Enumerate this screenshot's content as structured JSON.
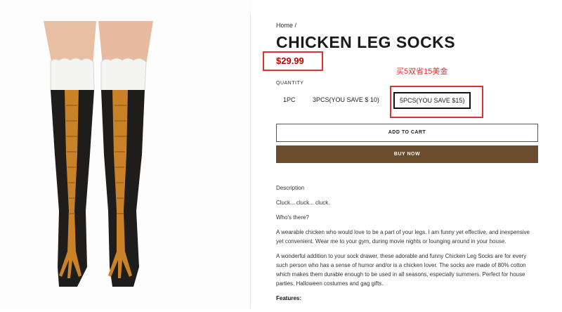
{
  "breadcrumb": "Home /",
  "title": "CHICKEN LEG SOCKS",
  "price": "$29.99",
  "promo_note": "买5双省15美金",
  "quantity": {
    "label": "QUANTITY",
    "options": [
      "1PC",
      "3PCS(YOU SAVE $ 10)",
      "5PCS(YOU SAVE $15)"
    ],
    "selected": "5PCS(YOU SAVE $15)"
  },
  "buttons": {
    "add_to_cart": "ADD TO CART",
    "buy_now": "BUY NOW"
  },
  "description": {
    "heading": "Description",
    "p1": "Cluck... cluck... cluck.",
    "p2": "Who's there?",
    "p3": "A wearable chicken who would love to be a part of your legs. I am funny yet effective, and inexpensive yet convenient. Wear me to your gym, during movie nights or lounging around in your house.",
    "p4": "A wonderful addition to your sock drawer, these adorable and funny Chicken Leg Socks are for every such person who has a sense of humor and/or is a chicken lover. The socks are made of 80% cotton which makes them durable enough to be used in all seasons, especially summers. Perfect for house parties, Halloween costumes and gag gifts.",
    "features": "Features:"
  },
  "colors": {
    "price": "#c00000",
    "annotation": "#e03030",
    "buy_button": "#6b4c2c"
  }
}
